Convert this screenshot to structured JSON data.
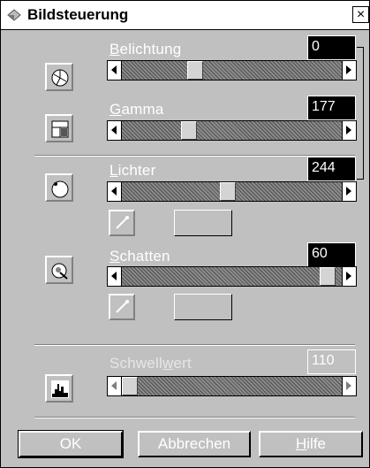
{
  "window": {
    "title": "Bildsteuerung",
    "close_glyph": "×"
  },
  "exposure": {
    "label_first": "B",
    "label_rest": "elichtung",
    "value": "0",
    "level": 0.32,
    "icon": "exposure-icon"
  },
  "gamma": {
    "label_first": "G",
    "label_rest": "amma",
    "value": "177",
    "level": 0.29,
    "icon": "gamma-icon"
  },
  "highlights": {
    "label_first": "L",
    "label_rest": "ichter",
    "value": "244",
    "level": 0.48,
    "icon": "highlight-icon"
  },
  "shadows": {
    "label_first": "S",
    "label_rest": "chatten",
    "value": "60",
    "level": 0.97,
    "icon": "shadow-icon"
  },
  "threshold": {
    "label_pre": "Schwell",
    "label_u": "w",
    "label_post": "ert",
    "value": "110",
    "level": 0.0,
    "icon": "threshold-icon"
  },
  "buttons": {
    "ok": "OK",
    "cancel": "Abbrechen",
    "help_first": "H",
    "help_rest": "ilfe"
  },
  "colors": {
    "face": "#c0c0c0",
    "value_bg": "#000000",
    "text": "#ffffff"
  }
}
